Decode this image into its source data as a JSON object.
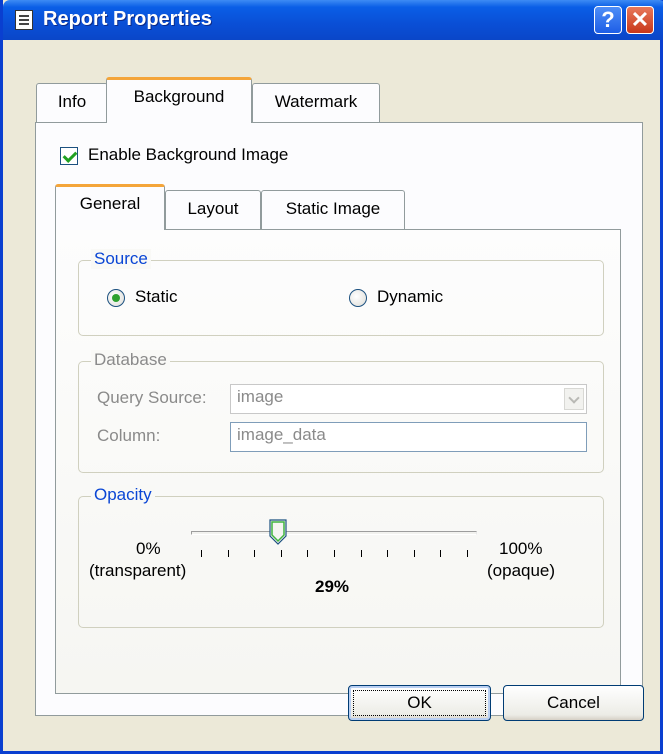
{
  "window": {
    "title": "Report Properties",
    "help_label": "?",
    "close_label": "✕"
  },
  "tabs": [
    {
      "label": "Info",
      "active": false
    },
    {
      "label": "Background",
      "active": true
    },
    {
      "label": "Watermark",
      "active": false
    }
  ],
  "enable_background": {
    "label": "Enable Background Image",
    "checked": true
  },
  "subtabs": [
    {
      "label": "General",
      "active": true
    },
    {
      "label": "Layout",
      "active": false
    },
    {
      "label": "Static Image",
      "active": false
    }
  ],
  "source": {
    "legend": "Source",
    "options": [
      {
        "label": "Static",
        "checked": true
      },
      {
        "label": "Dynamic",
        "checked": false
      }
    ]
  },
  "database": {
    "legend": "Database",
    "query_source_label": "Query Source:",
    "query_source_value": "image",
    "column_label": "Column:",
    "column_value": "image_data"
  },
  "opacity": {
    "legend": "Opacity",
    "min_label": "0%",
    "min_sub": "(transparent)",
    "max_label": "100%",
    "max_sub": "(opaque)",
    "value_label": "29%",
    "value": 0.29
  },
  "buttons": {
    "ok": "OK",
    "cancel": "Cancel"
  },
  "icons": {
    "title": "document-icon",
    "help": "help-icon",
    "close": "close-icon"
  },
  "colors": {
    "titlebar": "#0a4fd6",
    "tab_highlight": "#f4a53a",
    "legend_blue": "#0a46d5",
    "close": "#c8371a"
  }
}
